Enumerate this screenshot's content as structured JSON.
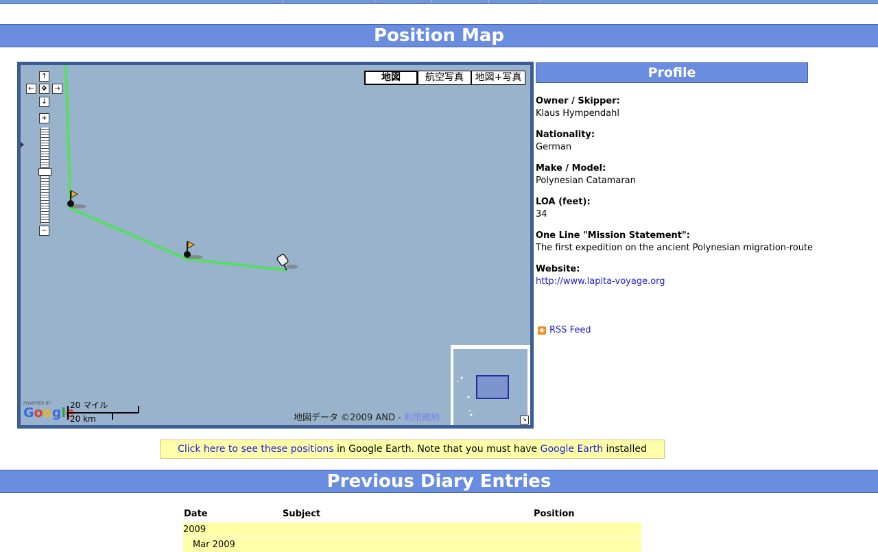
{
  "sections": {
    "position_map": "Position Map",
    "previous_diary": "Previous Diary Entries"
  },
  "map": {
    "type_buttons": [
      "地図",
      "航空写真",
      "地図+写真"
    ],
    "active_type": "地図",
    "pan": {
      "up": "↑",
      "left": "←",
      "center": "✥",
      "right": "→",
      "down": "↓"
    },
    "zoom_in": "+",
    "zoom_out": "−",
    "powered_by": "POWERED BY",
    "logo_text": "Google",
    "scale_top": "20 マイル",
    "scale_bottom": "20 km",
    "copyright": "地図データ ©2009 AND - ",
    "terms": "利用規約",
    "overview_toggle": "↘",
    "track_color": "#55dd66",
    "water_color": "#99b3cc"
  },
  "profile": {
    "title": "Profile",
    "owner_label": "Owner / Skipper:",
    "owner": "Klaus Hympendahl",
    "nationality_label": "Nationality:",
    "nationality": "German",
    "make_label": "Make / Model:",
    "make": "Polynesian Catamaran",
    "loa_label": "LOA (feet):",
    "loa": "34",
    "mission_label": "One Line \"Mission Statement\":",
    "mission": "The first expedition on the ancient Polynesian migration-route",
    "website_label": "Website:",
    "website": "http://www.lapita-voyage.org",
    "rss": "RSS Feed"
  },
  "google_earth": {
    "link1": "Click here to see these positions",
    "text1": " in Google Earth. Note that you must have ",
    "link2": "Google Earth",
    "text2": " installed"
  },
  "diary": {
    "columns": [
      "Date",
      "Subject",
      "Position"
    ],
    "year": "2009",
    "month": "Mar 2009"
  }
}
